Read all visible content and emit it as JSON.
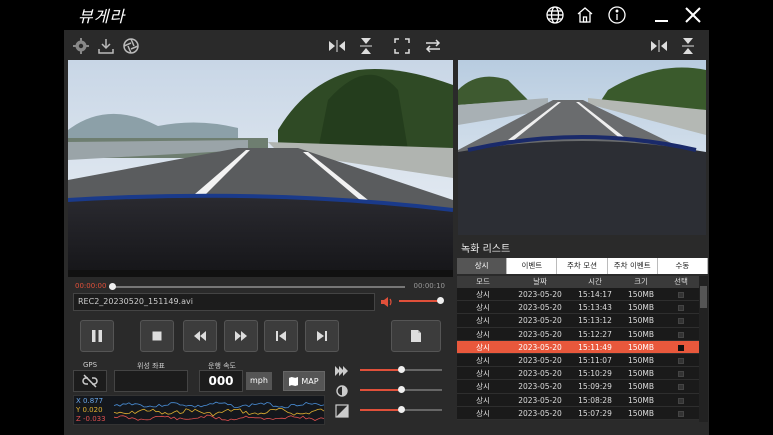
{
  "app": {
    "logo": "뷰게라"
  },
  "icons": {
    "globe": "globe-icon",
    "home": "home-icon",
    "info": "info-icon",
    "minimize": "minimize-icon",
    "close": "close-icon",
    "settings": "gear-icon",
    "download": "download-icon",
    "aperture": "aperture-icon",
    "flip_h": "flip-horizontal-icon",
    "flip_v": "flip-vertical-icon",
    "fullscreen": "fullscreen-icon",
    "swap": "swap-icon"
  },
  "player": {
    "elapsed": "00:00:00",
    "duration": "00:00:10",
    "progress": 0.0,
    "filename": "REC2_20230520_151149.avi",
    "volume": 0.95
  },
  "gps": {
    "gps_label": "GPS",
    "coord_label": "위성 좌표",
    "speed_label": "운행 속도",
    "speed_value": "000",
    "unit": "mph",
    "map_label": "MAP"
  },
  "accel": {
    "x": "X 0.877",
    "y": "Y 0.020",
    "z": "Z -0.033"
  },
  "adjust": {
    "speed": 0.5,
    "brightness": 0.5,
    "contrast": 0.5
  },
  "colors": {
    "accent": "#e8583c",
    "x_line": "#4a8fd8",
    "y_line": "#e0b030",
    "z_line": "#e05050"
  },
  "recordings": {
    "title": "녹화 리스트",
    "tabs": [
      "상시",
      "이벤트",
      "주차 모션",
      "주차 이벤트",
      "수동"
    ],
    "active_tab": 0,
    "columns": [
      "모드",
      "날짜",
      "시간",
      "크기",
      "선택"
    ],
    "rows": [
      [
        "상시",
        "2023-05-20",
        "15:14:17",
        "150MB"
      ],
      [
        "상시",
        "2023-05-20",
        "15:13:43",
        "150MB"
      ],
      [
        "상시",
        "2023-05-20",
        "15:13:12",
        "150MB"
      ],
      [
        "상시",
        "2023-05-20",
        "15:12:27",
        "150MB"
      ],
      [
        "상시",
        "2023-05-20",
        "15:11:49",
        "150MB"
      ],
      [
        "상시",
        "2023-05-20",
        "15:11:07",
        "150MB"
      ],
      [
        "상시",
        "2023-05-20",
        "15:10:29",
        "150MB"
      ],
      [
        "상시",
        "2023-05-20",
        "15:09:29",
        "150MB"
      ],
      [
        "상시",
        "2023-05-20",
        "15:08:28",
        "150MB"
      ],
      [
        "상시",
        "2023-05-20",
        "15:07:29",
        "150MB"
      ]
    ],
    "selected_row": 4
  }
}
